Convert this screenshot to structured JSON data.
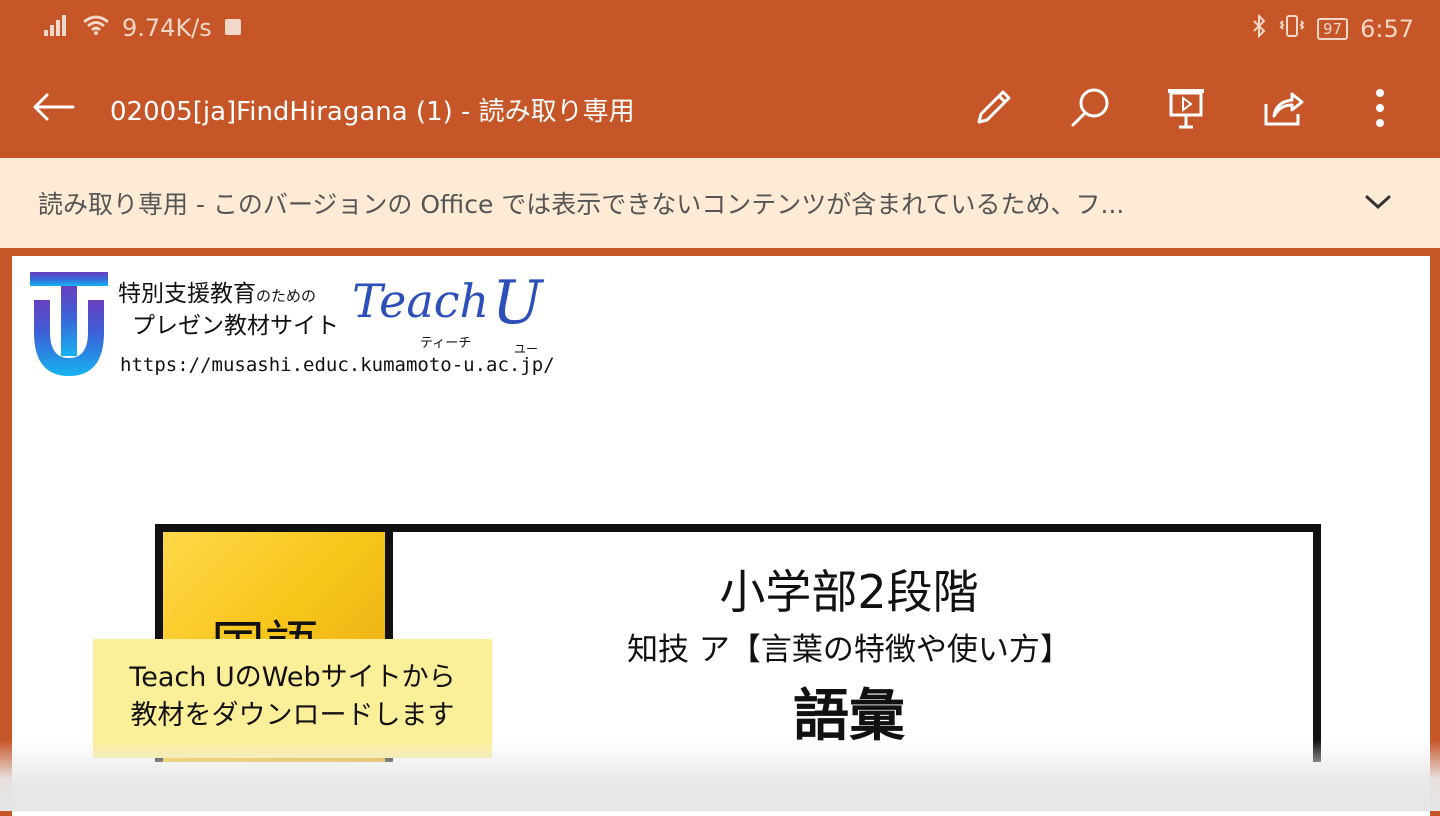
{
  "status_bar": {
    "speed": "9.74K/s",
    "battery": "97",
    "time": "6:57"
  },
  "app_bar": {
    "title": "02005[ja]FindHiragana (1) - 読み取り専用",
    "icons": [
      "back-arrow-icon",
      "pencil-icon",
      "search-icon",
      "present-icon",
      "share-icon",
      "more-icon"
    ]
  },
  "notice": {
    "text": "読み取り専用 - このバージョンの Office では表示できないコンテンツが含まれているため、フ..."
  },
  "slide": {
    "logo": {
      "line1": "特別支援教育",
      "line1_small": "のための",
      "line2": "プレゼン教材サイト",
      "teach": "Teach",
      "u": "U",
      "teach_kana": "ティーチ",
      "u_kana": "ユー",
      "url": "https://musashi.educ.kumamoto-u.ac.jp/"
    },
    "subject": "国語",
    "title_line1": "小学部2段階",
    "title_line2": "知技 ア【言葉の特徴や使い方】",
    "title_line3": "語彙"
  },
  "caption": {
    "line1": "Teach UのWebサイトから",
    "line2": "教材をダウンロードします"
  },
  "colors": {
    "accent": "#c65528",
    "notice_bg": "#fdebd6",
    "caption_bg": "#fcef9a"
  }
}
